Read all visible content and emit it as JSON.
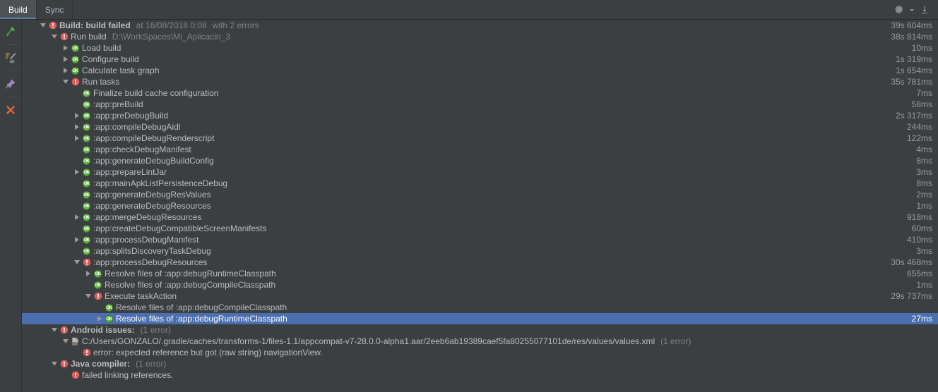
{
  "tabs": [
    {
      "label": "Build",
      "active": true
    },
    {
      "label": "Sync",
      "active": false
    }
  ],
  "toolbar": {
    "settings_label": "gear-icon",
    "settings_dropdown_label": "chevron-down-icon",
    "export_label": "export-icon"
  },
  "sidebar": {
    "items": [
      {
        "name": "toggle-build-view",
        "icon": "hammer-icon"
      },
      {
        "name": "toggle-soft-wrap",
        "icon": "sort-alphabetically-icon"
      },
      {
        "name": "pin-tab",
        "icon": "pin-icon"
      },
      {
        "name": "close-build-view",
        "icon": "close-icon"
      }
    ]
  },
  "tree": {
    "rows": [
      {
        "indent": 0,
        "twisty": "down",
        "icon": "error",
        "label": "Build: build failed",
        "bold": true,
        "sub": "at 16/08/2018 0:08",
        "sub2": "with 2 errors",
        "time": "39s 604ms"
      },
      {
        "indent": 1,
        "twisty": "down",
        "icon": "error",
        "label": "Run build",
        "sub": "D:\\WorkSpaces\\Mi_Aplicacin_3",
        "time": "38s 814ms"
      },
      {
        "indent": 2,
        "twisty": "right",
        "icon": "ok",
        "label": "Load build",
        "time": "10ms"
      },
      {
        "indent": 2,
        "twisty": "right",
        "icon": "ok",
        "label": "Configure build",
        "time": "1s 319ms"
      },
      {
        "indent": 2,
        "twisty": "right",
        "icon": "ok",
        "label": "Calculate task graph",
        "time": "1s 654ms"
      },
      {
        "indent": 2,
        "twisty": "down",
        "icon": "error",
        "label": "Run tasks",
        "time": "35s 781ms"
      },
      {
        "indent": 3,
        "twisty": "none",
        "icon": "ok",
        "label": "Finalize build cache configuration",
        "time": "7ms"
      },
      {
        "indent": 3,
        "twisty": "none",
        "icon": "ok",
        "label": ":app:preBuild",
        "time": "58ms"
      },
      {
        "indent": 3,
        "twisty": "right",
        "icon": "ok",
        "label": ":app:preDebugBuild",
        "time": "2s 317ms"
      },
      {
        "indent": 3,
        "twisty": "right",
        "icon": "ok",
        "label": ":app:compileDebugAidl",
        "time": "244ms"
      },
      {
        "indent": 3,
        "twisty": "right",
        "icon": "ok",
        "label": ":app:compileDebugRenderscript",
        "time": "122ms"
      },
      {
        "indent": 3,
        "twisty": "none",
        "icon": "ok",
        "label": ":app:checkDebugManifest",
        "time": "4ms"
      },
      {
        "indent": 3,
        "twisty": "none",
        "icon": "ok",
        "label": ":app:generateDebugBuildConfig",
        "time": "8ms"
      },
      {
        "indent": 3,
        "twisty": "right",
        "icon": "ok",
        "label": ":app:prepareLintJar",
        "time": "3ms"
      },
      {
        "indent": 3,
        "twisty": "none",
        "icon": "ok",
        "label": ":app:mainApkListPersistenceDebug",
        "time": "8ms"
      },
      {
        "indent": 3,
        "twisty": "none",
        "icon": "ok",
        "label": ":app:generateDebugResValues",
        "time": "2ms"
      },
      {
        "indent": 3,
        "twisty": "none",
        "icon": "ok",
        "label": ":app:generateDebugResources",
        "time": "1ms"
      },
      {
        "indent": 3,
        "twisty": "right",
        "icon": "ok",
        "label": ":app:mergeDebugResources",
        "time": "918ms"
      },
      {
        "indent": 3,
        "twisty": "none",
        "icon": "ok",
        "label": ":app:createDebugCompatibleScreenManifests",
        "time": "60ms"
      },
      {
        "indent": 3,
        "twisty": "right",
        "icon": "ok",
        "label": ":app:processDebugManifest",
        "time": "410ms"
      },
      {
        "indent": 3,
        "twisty": "none",
        "icon": "ok",
        "label": ":app:splitsDiscoveryTaskDebug",
        "time": "3ms"
      },
      {
        "indent": 3,
        "twisty": "down",
        "icon": "error",
        "label": ":app:processDebugResources",
        "time": "30s 468ms"
      },
      {
        "indent": 4,
        "twisty": "right",
        "icon": "ok",
        "label": "Resolve files of :app:debugRuntimeClasspath",
        "time": "655ms"
      },
      {
        "indent": 4,
        "twisty": "none",
        "icon": "ok",
        "label": "Resolve files of :app:debugCompileClasspath",
        "time": "1ms"
      },
      {
        "indent": 4,
        "twisty": "down",
        "icon": "error",
        "label": "Execute taskAction",
        "time": "29s 737ms"
      },
      {
        "indent": 5,
        "twisty": "none",
        "icon": "ok",
        "label": "Resolve files of :app:debugCompileClasspath",
        "time": ""
      },
      {
        "indent": 5,
        "twisty": "right",
        "icon": "ok",
        "label": "Resolve files of :app:debugRuntimeClasspath",
        "time": "27ms",
        "selected": true
      },
      {
        "indent": 1,
        "twisty": "down",
        "icon": "error",
        "label": "Android issues:",
        "bold": true,
        "sub": "(1 error)",
        "time": ""
      },
      {
        "indent": 2,
        "twisty": "down",
        "icon": "xml",
        "label": "C:/Users/GONZALO/.gradle/caches/transforms-1/files-1.1/appcompat-v7-28.0.0-alpha1.aar/2eeb6ab19389caef5fa80255077101de/res/values/values.xml",
        "sub": "(1 error)",
        "time": ""
      },
      {
        "indent": 3,
        "twisty": "none",
        "icon": "error",
        "label": "error: expected reference but got (raw string) navigationView.",
        "time": ""
      },
      {
        "indent": 1,
        "twisty": "down",
        "icon": "error",
        "label": "Java compiler:",
        "bold": true,
        "sub": "(1 error)",
        "time": ""
      },
      {
        "indent": 2,
        "twisty": "none",
        "icon": "error",
        "label": "failed linking references.",
        "time": ""
      }
    ]
  },
  "colors": {
    "background": "#3c3f41",
    "selection": "#4b6eaf",
    "text": "#bbbbbb",
    "muted": "#808080",
    "ok_green": "#62b543",
    "error_red": "#db5c5c",
    "tab_active": "#4e5254"
  }
}
